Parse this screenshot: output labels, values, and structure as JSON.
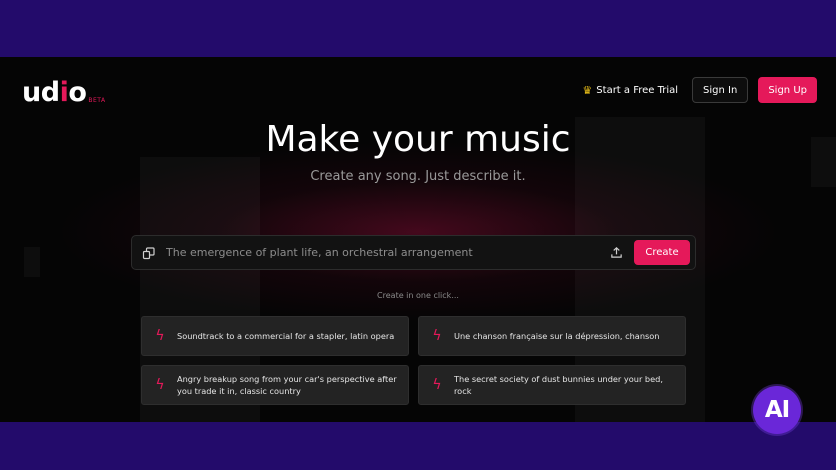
{
  "brand": {
    "logo_text_before": "ud",
    "logo_text_after": "o",
    "beta": "BETA"
  },
  "nav": {
    "trial_label": "Start a Free Trial",
    "signin_label": "Sign In",
    "signup_label": "Sign Up"
  },
  "hero": {
    "title": "Make your music",
    "subtitle": "Create any song. Just describe it."
  },
  "prompt": {
    "placeholder": "The emergence of plant life, an orchestral arrangement",
    "create_label": "Create"
  },
  "one_click_label": "Create in one click...",
  "suggestions": [
    "Soundtrack to a commercial for a stapler, latin opera",
    "Une chanson française sur la dépression, chanson",
    "Angry breakup song from your car's perspective after you trade it in, classic country",
    "The secret society of dust bunnies under your bed, rock"
  ],
  "badge_text": "AI",
  "colors": {
    "accent": "#e5195a",
    "frame": "#230b6b",
    "badge": "#6a27d8"
  },
  "icons": {
    "trial": "crown-icon",
    "prompt_left": "shuffle-icon",
    "prompt_right": "upload-icon",
    "suggestion": "lightning-icon"
  }
}
